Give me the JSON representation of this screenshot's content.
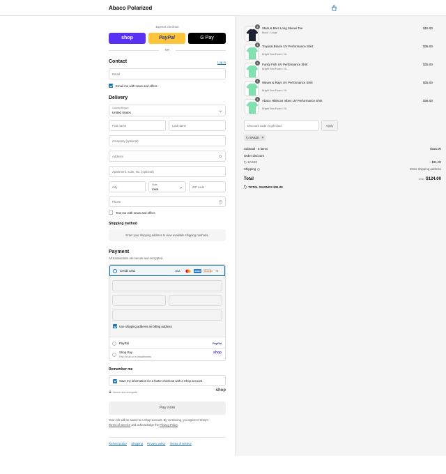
{
  "header": {
    "brand": "Abaco Polarized"
  },
  "express": {
    "label": "Express checkout",
    "shop": "shop",
    "paypal": "PayPal",
    "gpay": "G Pay",
    "or": "OR"
  },
  "contact": {
    "title": "Contact",
    "login": "Log in",
    "email_placeholder": "Email",
    "news": "Email me with news and offers"
  },
  "delivery": {
    "title": "Delivery",
    "country_label": "Country/Region",
    "country": "United States",
    "first_name": "First name",
    "last_name": "Last name",
    "company": "Company (optional)",
    "address": "Address",
    "apartment": "Apartment, suite, etc. (optional)",
    "city": "City",
    "state_label": "State",
    "state": "Iowa",
    "zip": "ZIP code",
    "phone": "Phone",
    "text_me": "Text me with news and offers"
  },
  "shipping": {
    "title": "Shipping method",
    "message": "Enter your shipping address to view available shipping methods."
  },
  "payment": {
    "title": "Payment",
    "subtitle": "All transactions are secure and encrypted.",
    "credit_card": "Credit card",
    "cards": [
      "VISA",
      "MC",
      "AMEX",
      "DISCOVER"
    ],
    "more_cards": "+4",
    "billing_same": "Use shipping address as billing address",
    "paypal": "PayPal",
    "paypal_logo": "PayPal",
    "shop_pay": "Shop Pay",
    "shop_pay_sub": "Pay in full or in installments",
    "shop_logo": "shop"
  },
  "remember": {
    "title": "Remember me",
    "save": "Save my information for a faster checkout with a Shop account",
    "secure": "Secure and encrypted",
    "shop_logo": "shop"
  },
  "pay_now": "Pay now",
  "legal": {
    "text1": "Your info will be saved to a Shop account. By continuing, you agree to Shop's",
    "terms": "Terms of Service",
    "text2": " and acknowledge the ",
    "privacy": "Privacy Policy",
    "end": "."
  },
  "footer_links": [
    "Refund policy",
    "Shipping",
    "Privacy policy",
    "Terms of service"
  ],
  "cart": {
    "items": [
      {
        "name": "Stars & Bars Long Sleeve Tee",
        "variant": "Black / Large",
        "price": "$15.00",
        "qty": "1",
        "color": "#1d2333"
      },
      {
        "name": "Tropical Bloom UV Performance Shirt",
        "variant": "Bright Sea Foam / XL",
        "price": "$35.00",
        "qty": "1",
        "color": "#7fe3b0"
      },
      {
        "name": "Funky Fish UV Performance Shirt",
        "variant": "Bright Sea Foam / XL",
        "price": "$35.00",
        "qty": "1",
        "color": "#7fe3b0"
      },
      {
        "name": "Waves & Rays UV Performance Shirt",
        "variant": "Bright Sea Foam / XL",
        "price": "$35.00",
        "qty": "1",
        "color": "#7fe3b0"
      },
      {
        "name": "Abaco Hibiscus Vibes UV Performance Shirt",
        "variant": "Bright Sea Foam / XL",
        "price": "$35.00",
        "qty": "1",
        "color": "#7fe3b0"
      }
    ],
    "discount_placeholder": "Discount code or gift card",
    "apply": "Apply",
    "code_tag": "SAS20",
    "subtotal_label": "Subtotal · 5 items",
    "subtotal": "$155.00",
    "order_discount": "Order discount",
    "discount_code": "SAS20",
    "discount_value": "− $31.00",
    "shipping_label": "Shipping",
    "shipping_value": "Enter shipping address",
    "total_label": "Total",
    "currency": "USD",
    "total": "$124.00",
    "savings_label": "TOTAL SAVINGS",
    "savings": "$31.00"
  },
  "colors": {
    "accent": "#1773b0",
    "shop": "#5a31f4",
    "paypal": "#ffc439"
  }
}
